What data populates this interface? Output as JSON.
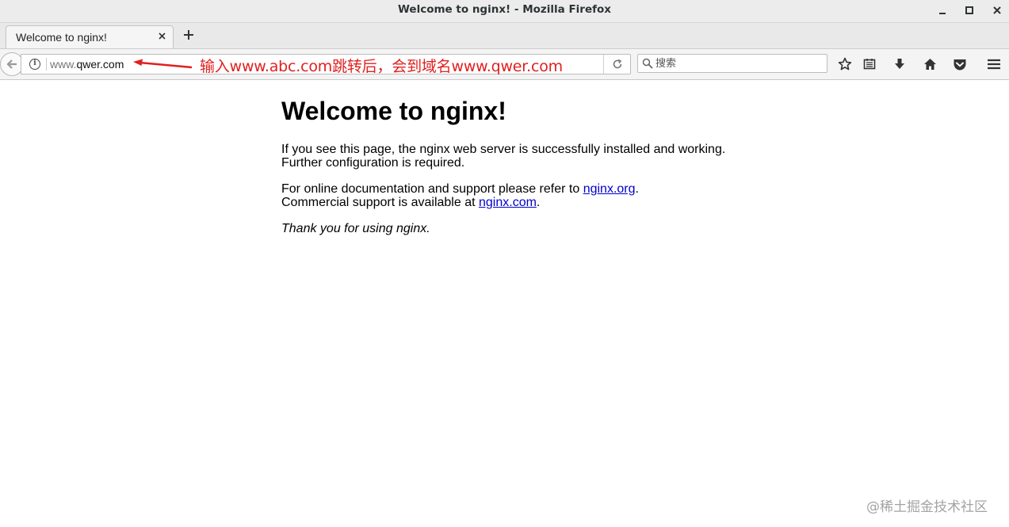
{
  "window": {
    "title": "Welcome to nginx! - Mozilla Firefox"
  },
  "tabs": [
    {
      "label": "Welcome to nginx!"
    }
  ],
  "navbar": {
    "url_prefix": "www.",
    "url_host": "qwer.com",
    "search_placeholder": "搜索",
    "annotation": "输入www.abc.com跳转后，会到域名www.qwer.com"
  },
  "icons": {
    "back": "back-arrow-icon",
    "info": "info-icon",
    "reload": "reload-icon",
    "search": "search-icon",
    "bookmark": "star-icon",
    "library": "reading-list-icon",
    "download": "download-icon",
    "home": "home-icon",
    "pocket": "pocket-icon",
    "menu": "hamburger-menu-icon"
  },
  "page": {
    "heading": "Welcome to nginx!",
    "p1_line1": "If you see this page, the nginx web server is successfully installed and working.",
    "p1_line2": "Further configuration is required.",
    "p2_line1_text": "For online documentation and support please refer to ",
    "p2_line1_link": "nginx.org",
    "p2_line1_end": ".",
    "p2_line2_text": "Commercial support is available at ",
    "p2_line2_link": "nginx.com",
    "p2_line2_end": ".",
    "thanks": "Thank you for using nginx."
  },
  "watermark": "@稀土掘金技术社区",
  "colors": {
    "annotation": "#e02020",
    "link": "#0000cc"
  }
}
